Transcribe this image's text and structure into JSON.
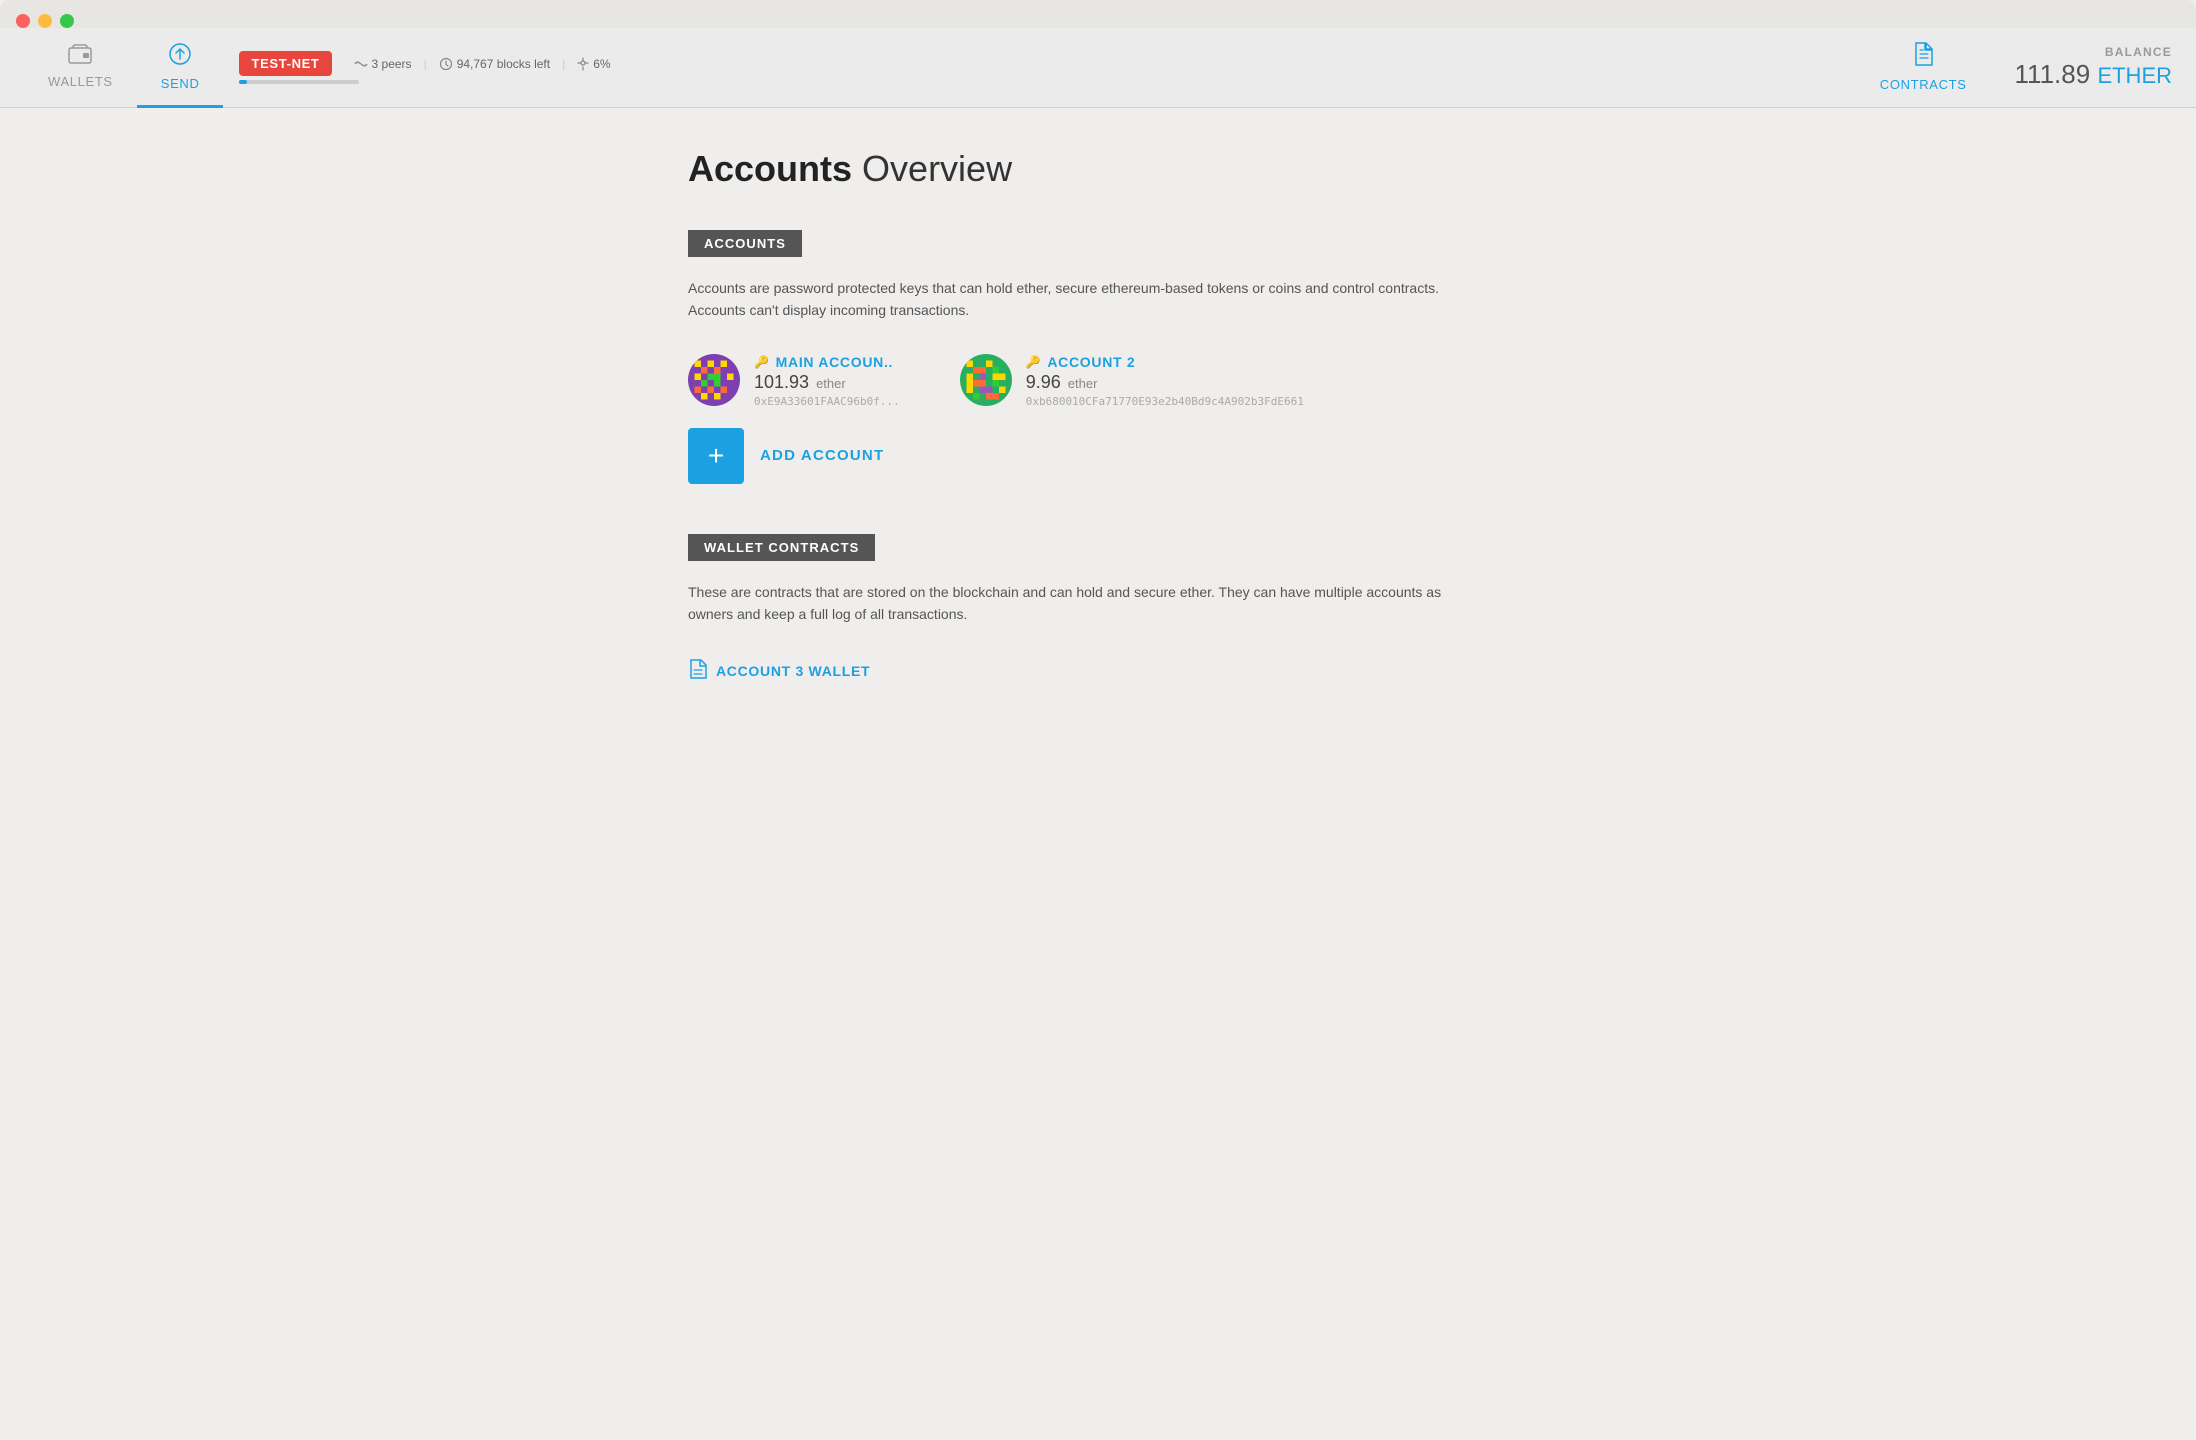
{
  "window": {
    "traffic_lights": [
      "red",
      "yellow",
      "green"
    ]
  },
  "topbar": {
    "wallets_label": "WALLETS",
    "send_label": "SEND",
    "network_badge": "TEST-NET",
    "peers": "3 peers",
    "blocks_left": "94,767 blocks left",
    "sync_percent": "6%",
    "sync_bar_width": "6%",
    "contracts_label": "CONTRACTS",
    "balance_label": "BALANCE",
    "balance_amount": "111.89",
    "balance_unit": "ETHER"
  },
  "page": {
    "title_bold": "Accounts",
    "title_light": "Overview"
  },
  "accounts_section": {
    "badge_label": "ACCOUNTS",
    "description": "Accounts are password protected keys that can hold ether, secure ethereum-based tokens or coins and control contracts. Accounts can't display incoming transactions.",
    "accounts": [
      {
        "name": "MAIN ACCOUN..",
        "balance": "101.93",
        "unit": "ether",
        "address": "0xE9A33601FAAC96b0f..."
      },
      {
        "name": "ACCOUNT 2",
        "balance": "9.96",
        "unit": "ether",
        "address": "0xb680010CFa71770E93e2b40Bd9c4A902b3FdE661"
      }
    ],
    "add_button_label": "+",
    "add_account_label": "ADD ACCOUNT"
  },
  "wallet_contracts_section": {
    "badge_label": "WALLET CONTRACTS",
    "description": "These are contracts that are stored on the blockchain and can hold and secure ether. They can have multiple accounts as owners and keep a full log of all transactions.",
    "wallet_preview_name": "ACCOUNT 3 WALLET"
  }
}
